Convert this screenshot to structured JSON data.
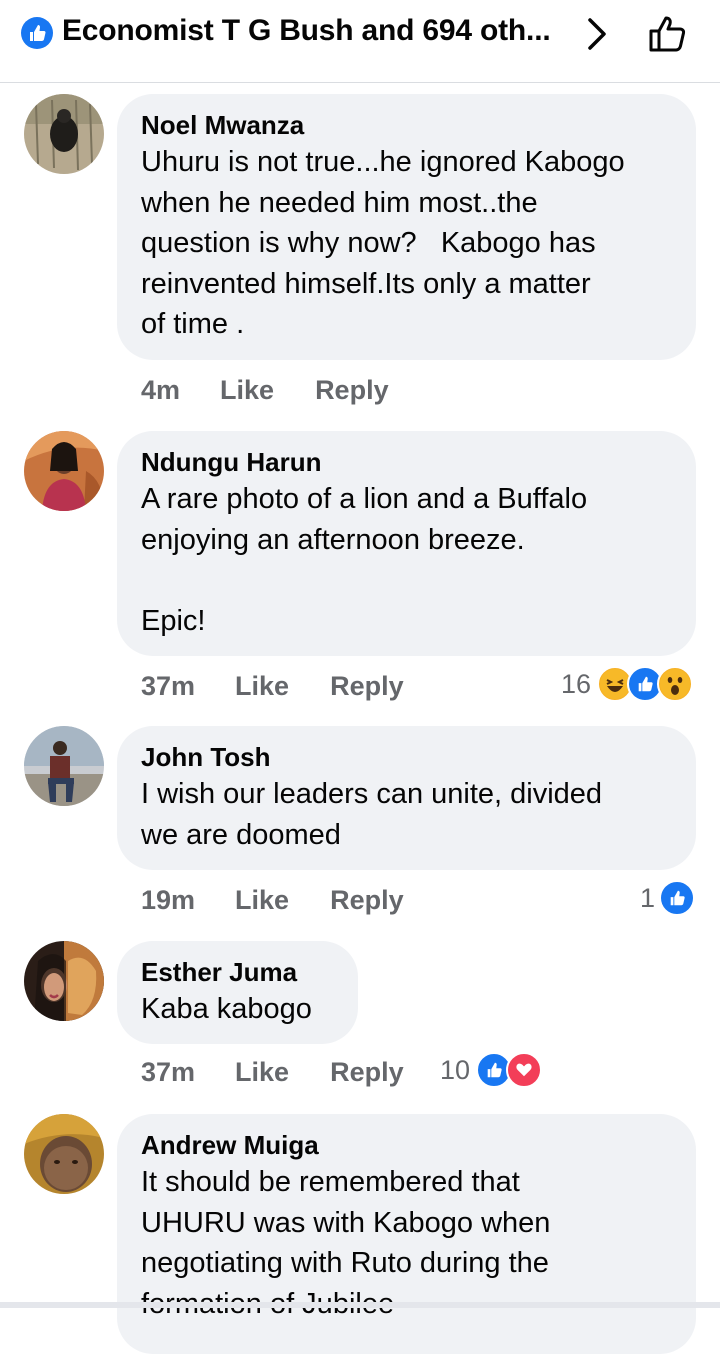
{
  "header": {
    "title": "Economist T G Bush and 694 oth...",
    "colors": {
      "accent": "#1877f2",
      "text": "#050505"
    }
  },
  "comments": [
    {
      "author": "Noel Mwanza",
      "text": "Uhuru is not true...he ignored Kabogo\nwhen he needed him most..the\nquestion is why now?   Kabogo has\nreinvented himself.Its only a matter\nof time .",
      "time": "4m",
      "like_label": "Like",
      "reply_label": "Reply",
      "reaction_count": "",
      "reactions": []
    },
    {
      "author": "Ndungu Harun",
      "text": "A rare photo of a lion and a Buffalo\nenjoying an afternoon breeze.\n\nEpic!",
      "time": "37m",
      "like_label": "Like",
      "reply_label": "Reply",
      "reaction_count": "16",
      "reactions": [
        "haha-icon",
        "like-icon",
        "wow-icon"
      ]
    },
    {
      "author": "John Tosh",
      "text": "I wish our leaders can unite, divided\nwe are doomed",
      "time": "19m",
      "like_label": "Like",
      "reply_label": "Reply",
      "reaction_count": "1",
      "reactions": [
        "like-icon"
      ]
    },
    {
      "author": "Esther Juma",
      "text": "Kaba kabogo",
      "time": "37m",
      "like_label": "Like",
      "reply_label": "Reply",
      "reaction_count": "10",
      "reactions": [
        "like-icon",
        "love-icon"
      ]
    },
    {
      "author": "Andrew Muiga",
      "text": "It should be remembered that\nUHURU was with Kabogo when\nnegotiating with Ruto during the\nformation of Jubilee",
      "time": "",
      "like_label": "",
      "reply_label": "",
      "reaction_count": "",
      "reactions": []
    }
  ]
}
